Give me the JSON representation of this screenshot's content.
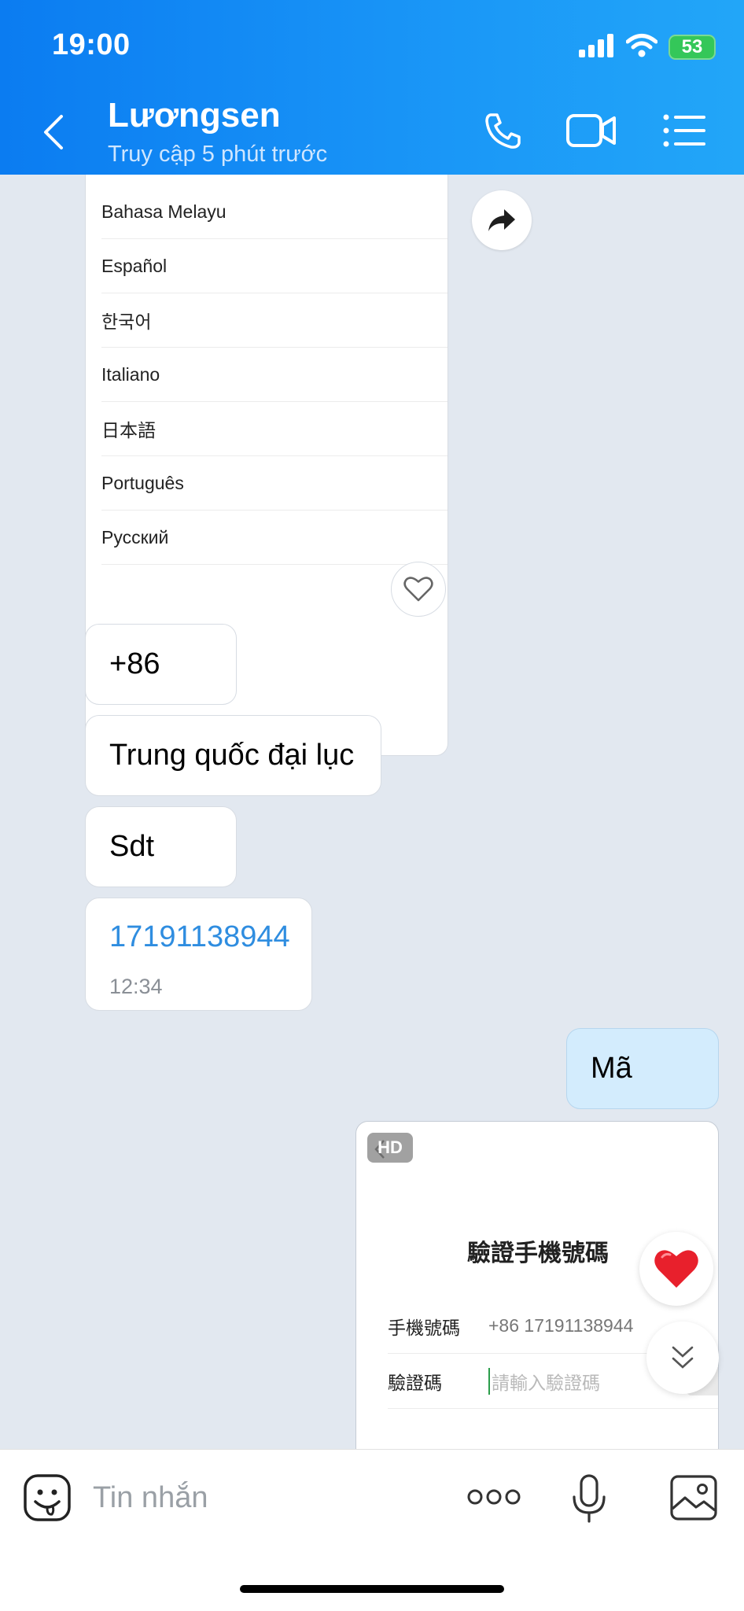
{
  "status_bar": {
    "time": "19:00",
    "battery": "53",
    "icons": [
      "signal-icon",
      "wifi-icon",
      "battery-icon"
    ]
  },
  "header": {
    "contact_name": "Lươngsen",
    "last_seen": "Truy cập 5 phút trước",
    "icons": [
      "back-icon",
      "phone-icon",
      "video-icon",
      "menu-icon"
    ]
  },
  "language_list": {
    "items": [
      "Bahasa Melayu",
      "Español",
      "한국어",
      "Italiano",
      "日本語",
      "Português",
      "Русский"
    ]
  },
  "messages": [
    {
      "from": "contact",
      "text": "+86"
    },
    {
      "from": "contact",
      "text": "Trung quốc đại lục"
    },
    {
      "from": "contact",
      "text": "Sdt"
    },
    {
      "from": "contact",
      "text": "17191138944",
      "time": "12:34",
      "is_phone": true
    },
    {
      "from": "me",
      "text": "Mã"
    }
  ],
  "image_message": {
    "badge": "HD",
    "title": "驗證手機號碼",
    "phone_label": "手機號碼",
    "phone_value": "+86 17191138944",
    "code_label": "驗證碼",
    "code_placeholder": "請輸入驗證碼"
  },
  "input": {
    "placeholder": "Tin nhắn"
  },
  "colors": {
    "header_gradient_start": "#0b7cf1",
    "header_gradient_end": "#22a6f8",
    "chat_background": "#e2e8f0",
    "my_bubble": "#d3ecfd",
    "link": "#2f8de0",
    "battery": "#34c759",
    "heart": "#e8202c"
  }
}
